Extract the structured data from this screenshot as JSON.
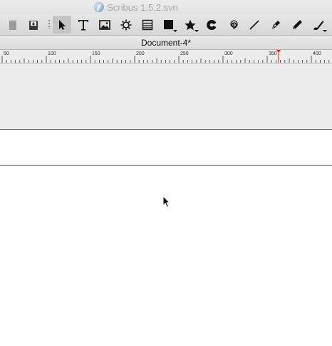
{
  "app": {
    "title": "Scribus 1.5.2.svn"
  },
  "toolbar": {
    "tools": [
      {
        "name": "copy-icon"
      },
      {
        "name": "save-icon"
      },
      {
        "name": "select-icon",
        "active": true
      },
      {
        "name": "text-frame-icon"
      },
      {
        "name": "image-frame-icon"
      },
      {
        "name": "render-frame-icon"
      },
      {
        "name": "table-icon"
      },
      {
        "name": "shape-icon"
      },
      {
        "name": "polygon-icon"
      },
      {
        "name": "arc-icon"
      },
      {
        "name": "spiral-icon"
      },
      {
        "name": "line-icon"
      },
      {
        "name": "bezier-icon"
      },
      {
        "name": "freehand-icon"
      },
      {
        "name": "calligraphic-icon"
      }
    ]
  },
  "document": {
    "tab_title": "Document-4*"
  },
  "ruler": {
    "labels": [
      "50",
      "100",
      "150",
      "200",
      "250",
      "300",
      "350",
      "400"
    ],
    "marker_color": "#e02020"
  },
  "colors": {
    "margin_top": "#d64848",
    "margin_guide": "#3a3a8a",
    "pasteboard": "#ececec",
    "page": "#ffffff"
  }
}
